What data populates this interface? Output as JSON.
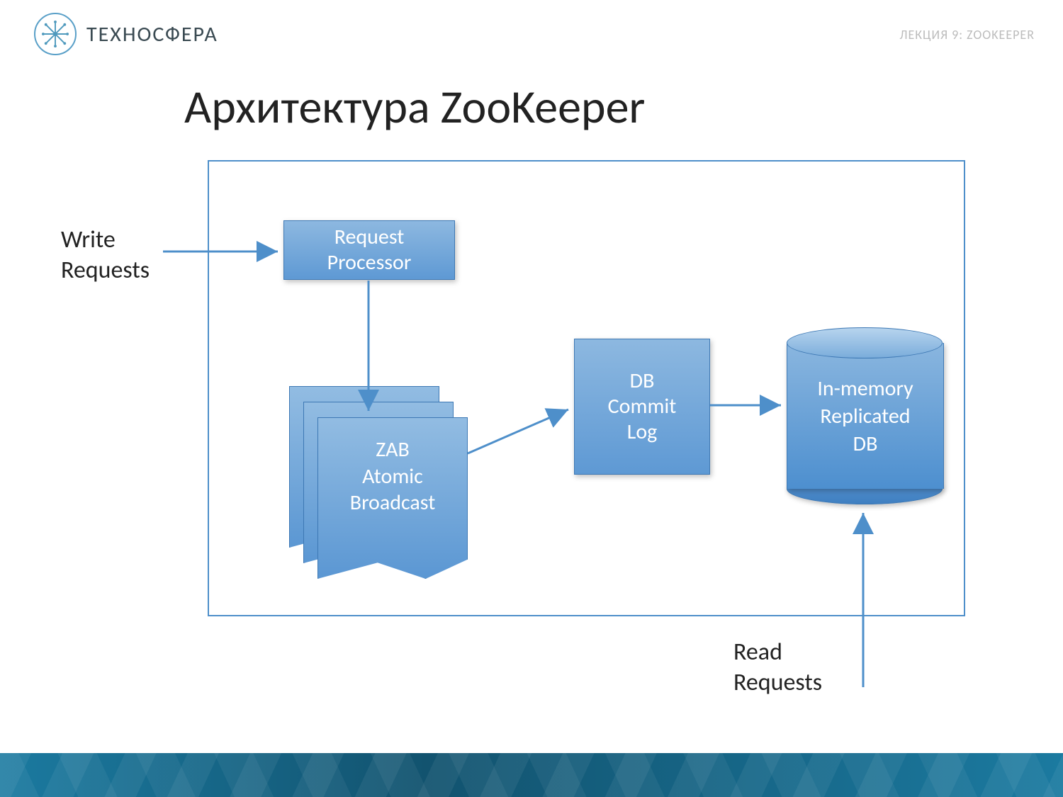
{
  "brand": "ТЕХНОСФЕРА",
  "lecture_label": "ЛЕКЦИЯ 9: ZOOKEEPER",
  "title": "Архитектура ZooKeeper",
  "labels": {
    "write_requests": "Write\nRequests",
    "read_requests": "Read\nRequests"
  },
  "nodes": {
    "request_processor": "Request\nProcessor",
    "zab": "ZAB\nAtomic\nBroadcast",
    "db_commit_log": "DB\nCommit\nLog",
    "in_memory_db": "In-memory\nReplicated\nDB"
  },
  "colors": {
    "box_border": "#3d78b4",
    "arrow": "#4e8fca",
    "brand_text": "#3a4a52"
  }
}
